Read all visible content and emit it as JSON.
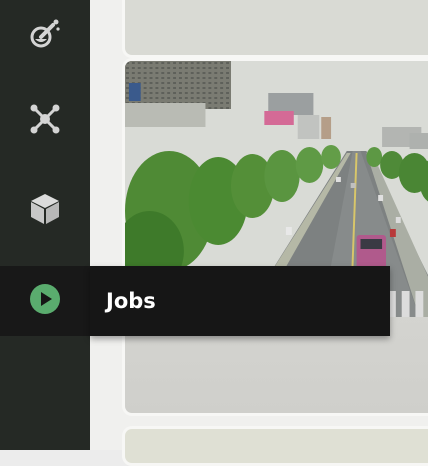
{
  "sidebar": {
    "items": [
      {
        "icon": "flask-icon"
      },
      {
        "icon": "network-icon"
      },
      {
        "icon": "cube-icon"
      },
      {
        "icon": "play-icon",
        "active": true
      }
    ]
  },
  "tooltip": {
    "label": "Jobs"
  },
  "colors": {
    "sidebar_bg": "#252925",
    "active_bg": "#181818",
    "icon": "#d4d4d4",
    "play_accent": "#5aac6e",
    "tooltip_bg": "#161616"
  }
}
